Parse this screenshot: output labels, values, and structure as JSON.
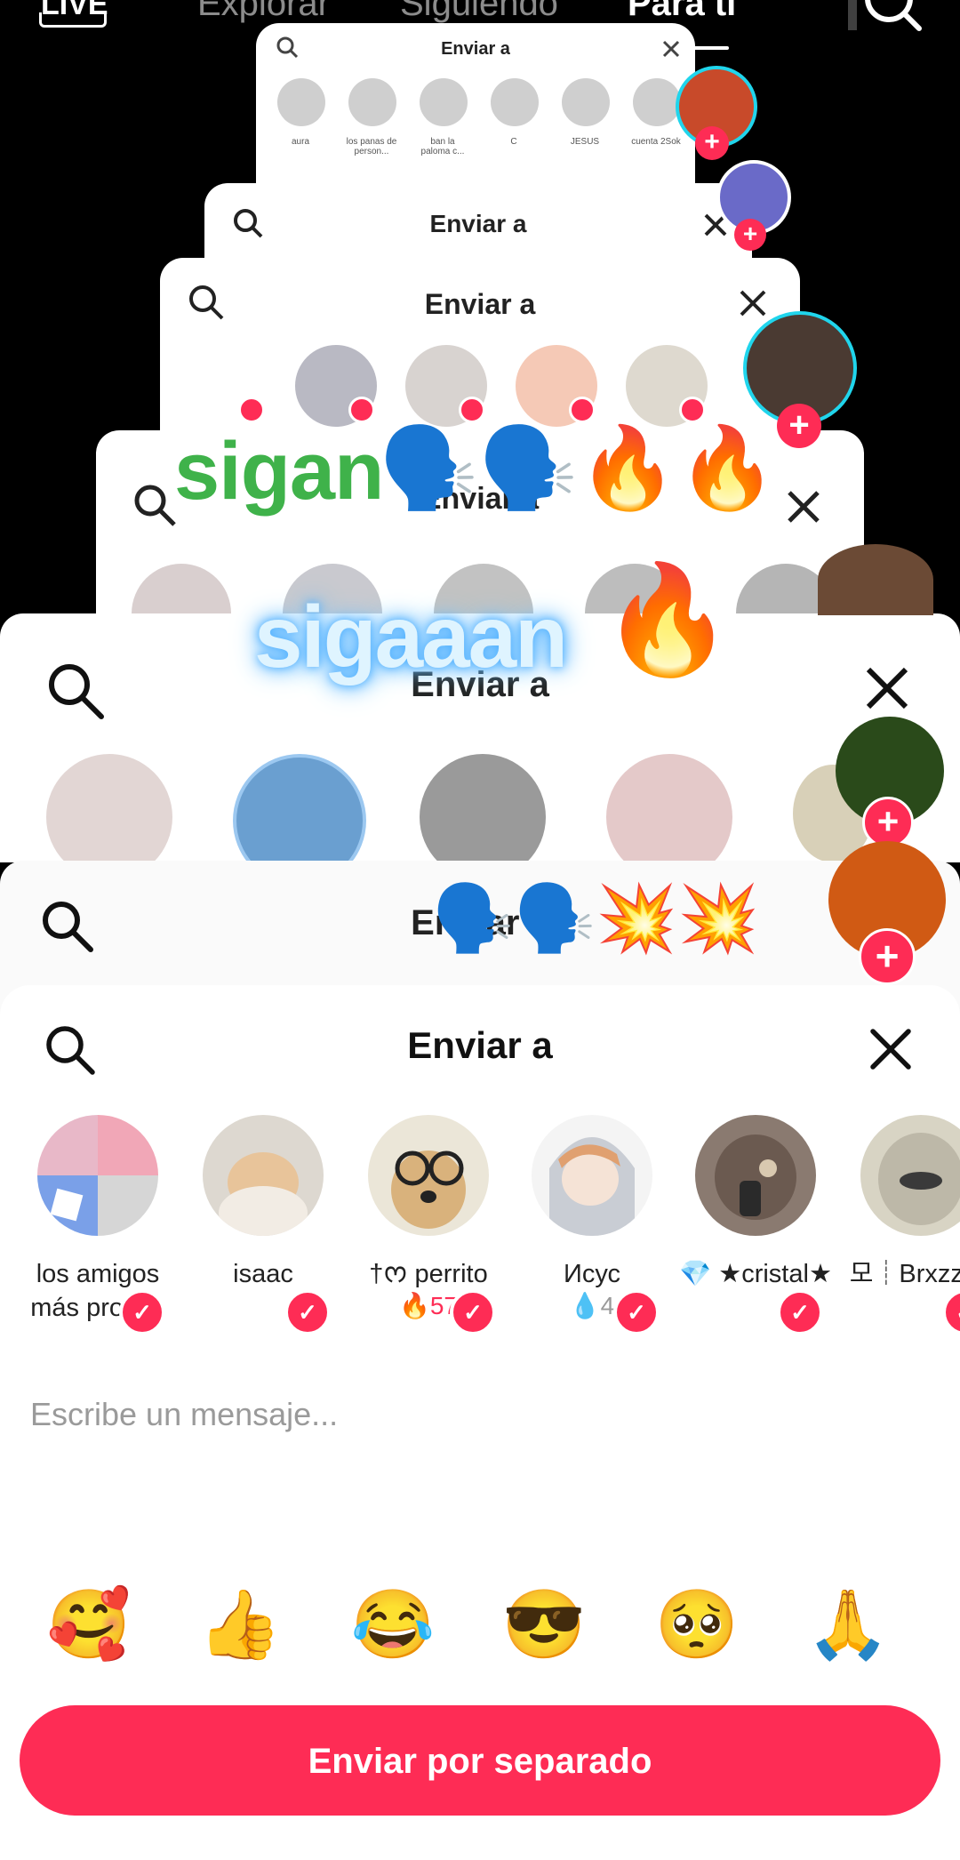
{
  "top_nav": {
    "live_label": "LIVE",
    "tabs": [
      {
        "label": "Explorar",
        "active": false
      },
      {
        "label": "Siguiendo",
        "active": false
      },
      {
        "label": "Para ti",
        "active": true
      }
    ],
    "search_icon": "search-icon"
  },
  "ghost_sheets": {
    "title": "Enviar a",
    "tiny_names": [
      "aura",
      "los panas de person...",
      "ban la paloma c...",
      "C",
      "JESUS",
      "cuenta 2Sok"
    ]
  },
  "overlays": {
    "green_text": "sigan",
    "green_emojis": "🗣️🗣️🔥🔥",
    "blue_text": "sigaaan",
    "blue_emoji": "🔥",
    "lower_emojis": "🗣️🗣️💥💥"
  },
  "side_avatars": {
    "plus": "+"
  },
  "share_sheet": {
    "title": "Enviar a",
    "contacts": [
      {
        "name": "los amigos más pros ...",
        "streak": ""
      },
      {
        "name": "isaac",
        "streak": ""
      },
      {
        "name": "†ᰔ perrito",
        "streak": "🔥57",
        "streak_color": "#fe2c55"
      },
      {
        "name": "Исус",
        "streak": "💧4",
        "streak_color": "#9a9a9a"
      },
      {
        "name": "💎 ★cristal★",
        "streak": ""
      },
      {
        "name": "모┊Brxzz ✕",
        "streak": ""
      }
    ],
    "message_placeholder": "Escribe un mensaje...",
    "reactions": [
      "🥰",
      "👍",
      "😂",
      "😎",
      "🥺",
      "🙏"
    ],
    "send_button": "Enviar por separado"
  },
  "colors": {
    "accent": "#fe2c55",
    "ring": "#20d5ec"
  }
}
